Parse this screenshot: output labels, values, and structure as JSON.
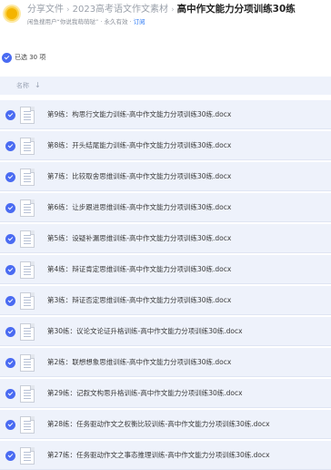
{
  "header": {
    "breadcrumbs": [
      "分享文件",
      "2023高考语文作文素材"
    ],
    "current": "高中作文能力分项训练30练",
    "owner_prefix": "闲鱼搜用户“你说我萌萌哒”",
    "validity": "· 永久有效 ·",
    "subscribe": "订阅"
  },
  "selection": {
    "count_text": "已选 30 项"
  },
  "list_header": {
    "name_label": "名称",
    "sort_icon": "arrow-down-icon"
  },
  "accent": "#4a6bf2",
  "files": [
    {
      "name": "第9练：构思行文能力训练-高中作文能力分项训练30练.docx"
    },
    {
      "name": "第8练：开头结尾能力训练-高中作文能力分项训练30练.docx"
    },
    {
      "name": "第7练：比较取舍思维训练-高中作文能力分项训练30练.docx"
    },
    {
      "name": "第6练：让步跟进思维训练-高中作文能力分项训练30练.docx"
    },
    {
      "name": "第5练：设疑补漏思维训练-高中作文能力分项训练30练.docx"
    },
    {
      "name": "第4练：辩证肯定思维训练-高中作文能力分项训练30练.docx"
    },
    {
      "name": "第3练：辩证否定思维训练-高中作文能力分项训练30练.docx"
    },
    {
      "name": "第30练：议论文论证升格训练-高中作文能力分项训练30练.docx"
    },
    {
      "name": "第2练：联想想象思维训练-高中作文能力分项训练30练.docx"
    },
    {
      "name": "第29练：记叙文构思升格训练-高中作文能力分项训练30练.docx"
    },
    {
      "name": "第28练：任务驱动作文之权衡比较训练-高中作文能力分项训练30练.docx"
    },
    {
      "name": "第27练：任务驱动作文之事态推理训练-高中作文能力分项训练30练.docx"
    }
  ]
}
